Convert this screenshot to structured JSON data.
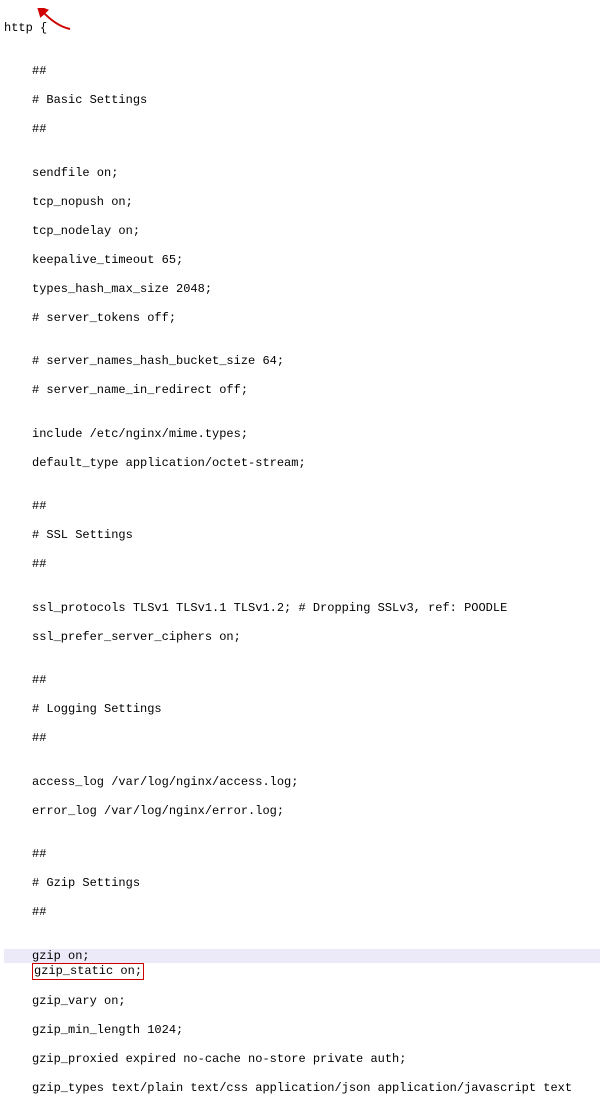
{
  "code": {
    "l1": "http {",
    "blank": "",
    "l3": "##",
    "l4": "# Basic Settings",
    "l5": "##",
    "l7": "sendfile on;",
    "l8": "tcp_nopush on;",
    "l9": "tcp_nodelay on;",
    "l10": "keepalive_timeout 65;",
    "l11": "types_hash_max_size 2048;",
    "l12": "# server_tokens off;",
    "l14": "# server_names_hash_bucket_size 64;",
    "l15": "# server_name_in_redirect off;",
    "l17": "include /etc/nginx/mime.types;",
    "l18": "default_type application/octet-stream;",
    "l20": "##",
    "l21": "# SSL Settings",
    "l22": "##",
    "l24": "ssl_protocols TLSv1 TLSv1.1 TLSv1.2; # Dropping SSLv3, ref: POODLE",
    "l25": "ssl_prefer_server_ciphers on;",
    "l27": "##",
    "l28": "# Logging Settings",
    "l29": "##",
    "l31": "access_log /var/log/nginx/access.log;",
    "l32": "error_log /var/log/nginx/error.log;",
    "l34": "##",
    "l35": "# Gzip Settings",
    "l36": "##",
    "l38": "gzip on;",
    "l39": "gzip_static on;",
    "l40": "gzip_vary on;",
    "l41": "gzip_min_length 1024;",
    "l42": "gzip_proxied expired no-cache no-store private auth;",
    "l43": "gzip_types text/plain text/css application/json application/javascript text"
  },
  "annotations": {
    "arrow_color": "#d00000",
    "red_box_color": "#d00000",
    "cursor_bg": "#eceaf8"
  }
}
